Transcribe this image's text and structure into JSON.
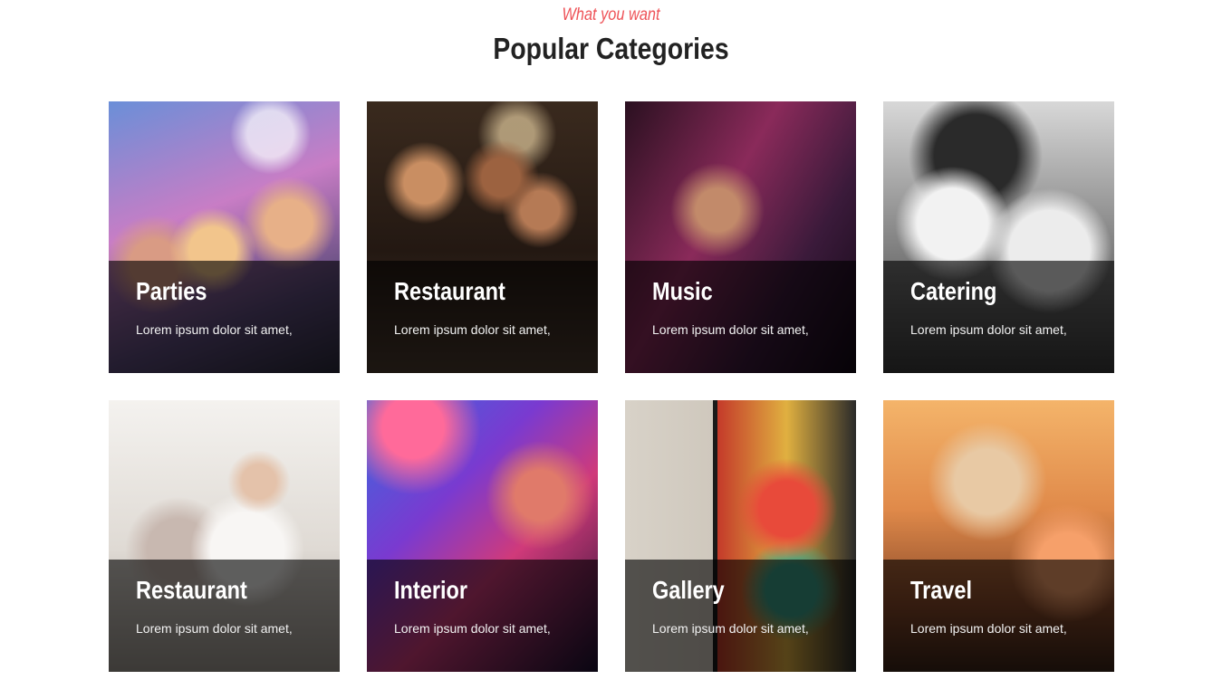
{
  "header": {
    "eyebrow": "What you want",
    "title": "Popular Categories"
  },
  "colors": {
    "accent": "#ee5257",
    "title": "#222222",
    "overlay": "rgba(0,0,0,0.62)"
  },
  "categories": [
    {
      "title": "Parties",
      "description": "Lorem ipsum dolor sit amet,"
    },
    {
      "title": "Restaurant",
      "description": "Lorem ipsum dolor sit amet,"
    },
    {
      "title": "Music",
      "description": "Lorem ipsum dolor sit amet,"
    },
    {
      "title": "Catering",
      "description": "Lorem ipsum dolor sit amet,"
    },
    {
      "title": "Restaurant",
      "description": "Lorem ipsum dolor sit amet,"
    },
    {
      "title": "Interior",
      "description": "Lorem ipsum dolor sit amet,"
    },
    {
      "title": "Gallery",
      "description": "Lorem ipsum dolor sit amet,"
    },
    {
      "title": "Travel",
      "description": "Lorem ipsum dolor sit amet,"
    }
  ]
}
